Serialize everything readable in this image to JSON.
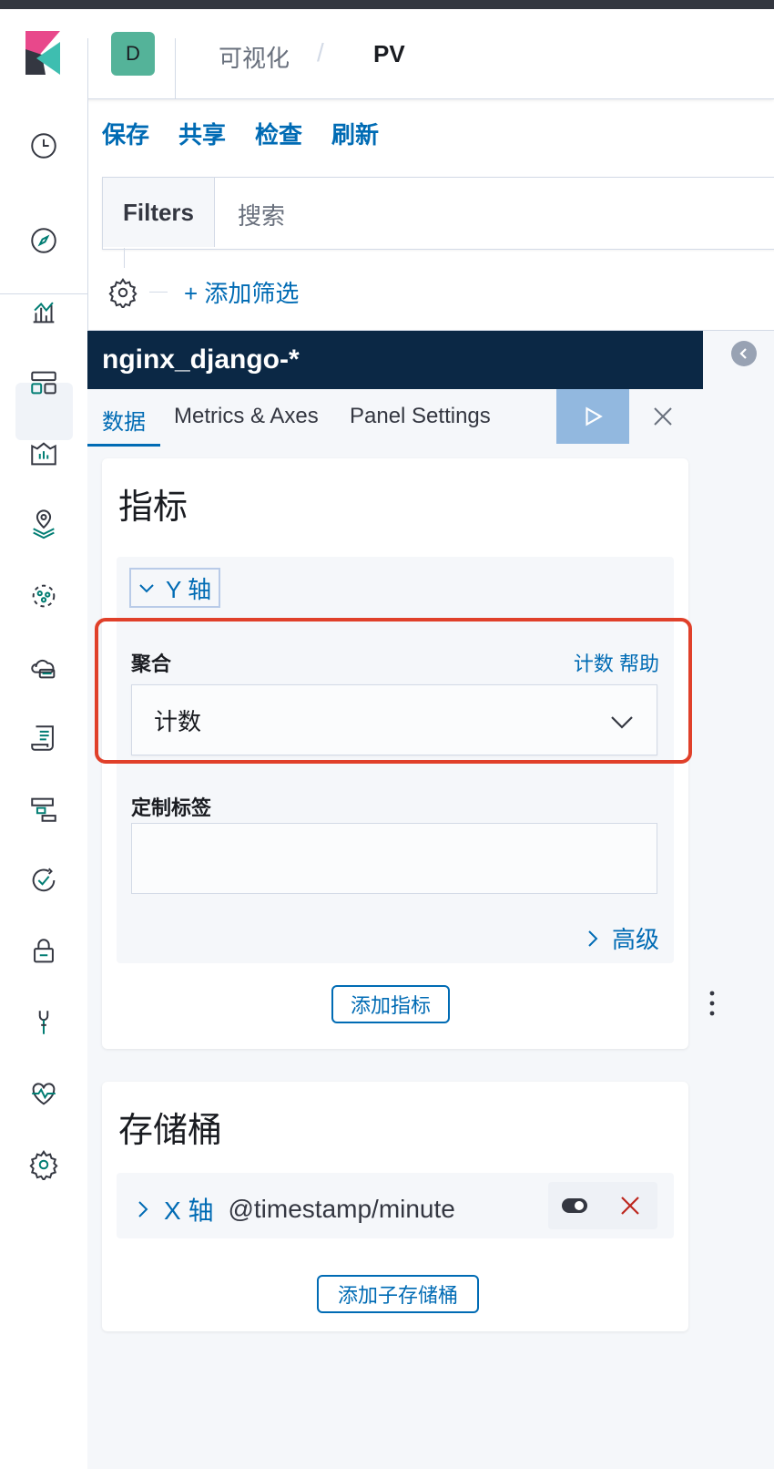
{
  "app": {
    "avatar_letter": "D",
    "breadcrumbs": [
      "可视化",
      "PV"
    ],
    "breadcrumb_separator": "/"
  },
  "toolbar": {
    "save": "保存",
    "share": "共享",
    "inspect": "检查",
    "refresh": "刷新"
  },
  "filterbar": {
    "filters_label": "Filters",
    "search_placeholder": "搜索",
    "add_filter": "+ 添加筛选"
  },
  "editor": {
    "index_pattern": "nginx_django-*",
    "tabs": [
      "数据",
      "Metrics & Axes",
      "Panel Settings"
    ],
    "active_tab": "数据"
  },
  "metrics": {
    "title": "指标",
    "y_axis_label": "Y 轴",
    "aggregation_label": "聚合",
    "help_link": "计数 帮助",
    "aggregation_value": "计数",
    "custom_label_label": "定制标签",
    "custom_label_value": "",
    "advanced": "高级",
    "add_metric": "添加指标"
  },
  "buckets": {
    "title": "存储桶",
    "x_axis_label": "X 轴",
    "x_axis_field": "@timestamp/minute",
    "add_sub_bucket": "添加子存储桶"
  },
  "colors": {
    "accent": "#006bb4",
    "index_header_bg": "#0b2845",
    "highlight_border": "#e0402a",
    "run_button": "#92b8df",
    "avatar_bg": "#54b399"
  },
  "sidebar_icons": [
    "clock-icon",
    "compass-icon",
    "visualize-icon",
    "dashboard-icon",
    "canvas-icon",
    "maps-icon",
    "ml-icon",
    "infrastructure-icon",
    "logs-icon",
    "apm-icon",
    "uptime-icon",
    "siem-icon",
    "dev-tools-icon",
    "monitoring-icon",
    "management-icon"
  ]
}
